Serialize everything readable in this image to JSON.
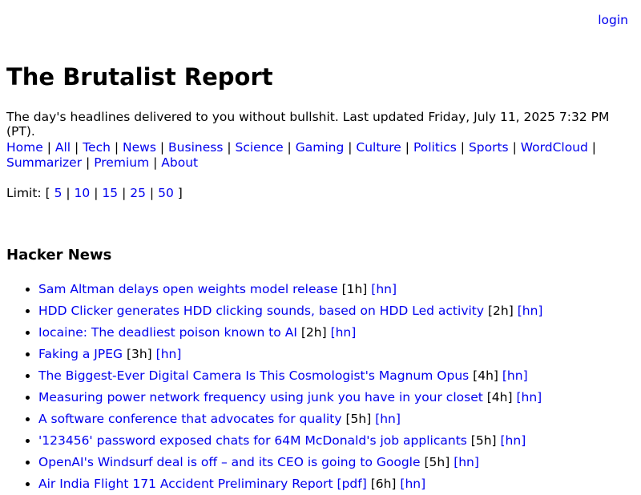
{
  "header": {
    "login_label": "login"
  },
  "site": {
    "title": "The Brutalist Report",
    "tagline": "The day's headlines delivered to you without bullshit. Last updated Friday, July 11, 2025 7:32 PM (PT)."
  },
  "nav": {
    "items": [
      {
        "label": "Home"
      },
      {
        "label": "All"
      },
      {
        "label": "Tech"
      },
      {
        "label": "News"
      },
      {
        "label": "Business"
      },
      {
        "label": "Science"
      },
      {
        "label": "Gaming"
      },
      {
        "label": "Culture"
      },
      {
        "label": "Politics"
      },
      {
        "label": "Sports"
      },
      {
        "label": "WordCloud"
      },
      {
        "label": "Summarizer"
      },
      {
        "label": "Premium"
      },
      {
        "label": "About"
      }
    ],
    "separator": "|"
  },
  "limit": {
    "prefix": "Limit: [",
    "suffix": "]",
    "options": [
      "5",
      "10",
      "15",
      "25",
      "50"
    ]
  },
  "section": {
    "title": "Hacker News",
    "discussion_label": "[hn]",
    "stories": [
      {
        "title": "Sam Altman delays open weights model release",
        "age": "[1h]"
      },
      {
        "title": "HDD Clicker generates HDD clicking sounds, based on HDD Led activity",
        "age": "[2h]"
      },
      {
        "title": "Iocaine: The deadliest poison known to AI",
        "age": "[2h]"
      },
      {
        "title": "Faking a JPEG",
        "age": "[3h]"
      },
      {
        "title": "The Biggest-Ever Digital Camera Is This Cosmologist's Magnum Opus",
        "age": "[4h]"
      },
      {
        "title": "Measuring power network frequency using junk you have in your closet",
        "age": "[4h]"
      },
      {
        "title": "A software conference that advocates for quality",
        "age": "[5h]"
      },
      {
        "title": "'123456' password exposed chats for 64M McDonald's job applicants",
        "age": "[5h]"
      },
      {
        "title": "OpenAI's Windsurf deal is off – and its CEO is going to Google",
        "age": "[5h]"
      },
      {
        "title": "Air India Flight 171 Accident Preliminary Report [pdf]",
        "age": "[6h]"
      }
    ]
  },
  "colors": {
    "link": "#0000ee",
    "text": "#000000",
    "background": "#ffffff"
  }
}
